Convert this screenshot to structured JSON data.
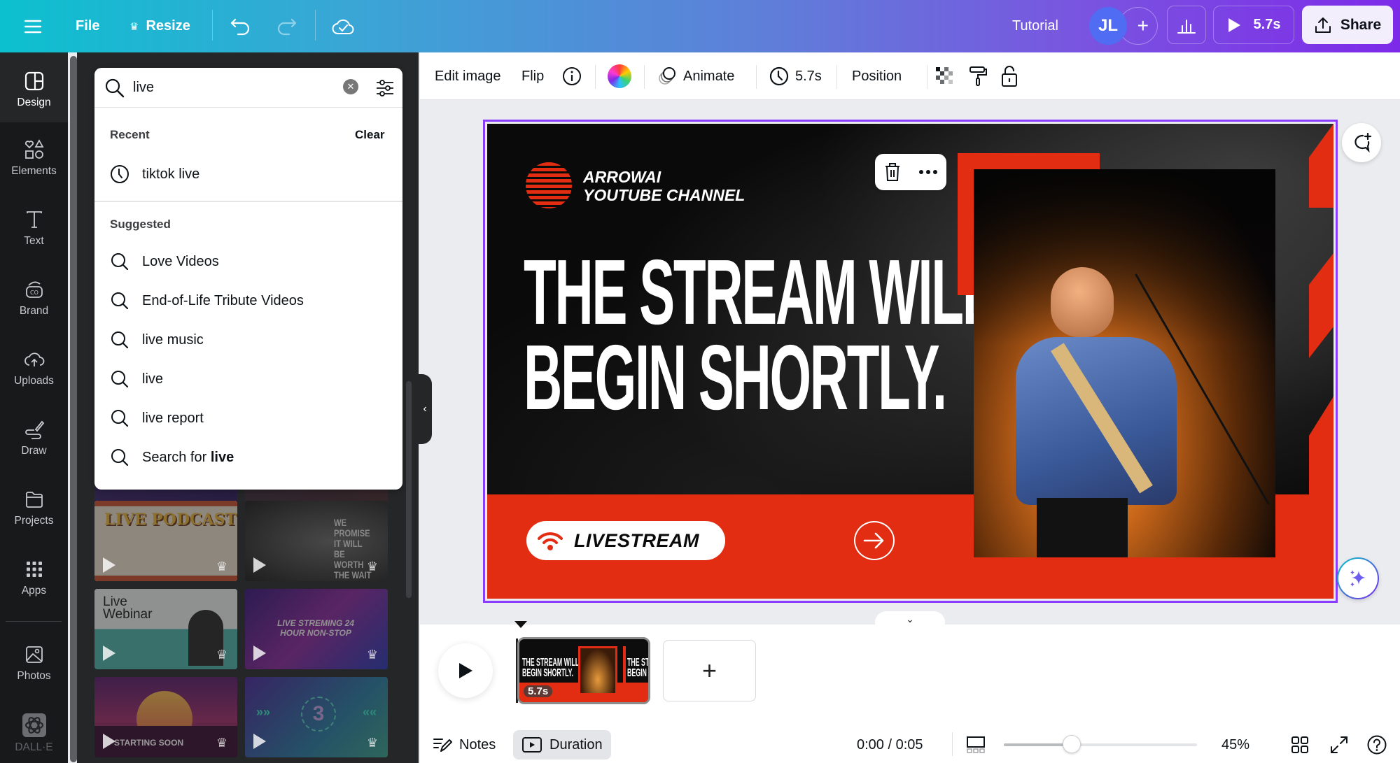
{
  "topbar": {
    "menu_icon": "hamburger-icon",
    "file_label": "File",
    "resize_label": "Resize",
    "resize_icon": "crown-icon",
    "undo_icon": "undo-icon",
    "redo_icon": "redo-icon",
    "saved_icon": "cloud-check-icon",
    "tutorial_label": "Tutorial",
    "avatar_initials": "JL",
    "add_collaborator": "+",
    "insights_icon": "bar-chart-icon",
    "present_duration": "5.7s",
    "share_label": "Share"
  },
  "rail": {
    "items": [
      {
        "label": "Design",
        "icon": "design-icon",
        "active": true
      },
      {
        "label": "Elements",
        "icon": "elements-icon"
      },
      {
        "label": "Text",
        "icon": "text-icon"
      },
      {
        "label": "Brand",
        "icon": "brand-icon"
      },
      {
        "label": "Uploads",
        "icon": "uploads-icon"
      },
      {
        "label": "Draw",
        "icon": "draw-icon"
      },
      {
        "label": "Projects",
        "icon": "projects-icon"
      },
      {
        "label": "Apps",
        "icon": "apps-icon"
      },
      {
        "label": "Photos",
        "icon": "photos-icon"
      },
      {
        "label": "DALL·E",
        "icon": "dalle-icon"
      }
    ]
  },
  "search": {
    "value": "live",
    "recent_label": "Recent",
    "clear_label": "Clear",
    "recent": [
      "tiktok live"
    ],
    "suggested_label": "Suggested",
    "suggested": [
      "Love Videos",
      "End-of-Life Tribute Videos",
      "live music",
      "live",
      "live report"
    ],
    "search_for_prefix": "Search for ",
    "search_for_term": "live"
  },
  "templates": [
    {
      "title": "LIVE PODCAST",
      "premium": true
    },
    {
      "title": "WE PROMISE IT WILL BE WORTH THE WAIT",
      "premium": true
    },
    {
      "title": "Live Webinar",
      "premium": true
    },
    {
      "title": "LIVE STREMING 24 HOUR NON-STOP",
      "premium": true
    },
    {
      "title": "STARTING SOON",
      "premium": true
    },
    {
      "title": "3",
      "premium": true
    }
  ],
  "context_toolbar": {
    "edit_image": "Edit image",
    "flip": "Flip",
    "animate": "Animate",
    "duration": "5.7s",
    "position": "Position"
  },
  "design": {
    "brand_line1": "ARROWAI",
    "brand_line2": "YOUTUBE CHANNEL",
    "headline_line1": "THE STREAM WILL",
    "headline_line2": "BEGIN SHORTLY.",
    "pill_label": "LIVESTREAM",
    "accent_color": "#e32d12"
  },
  "timeline": {
    "clip_duration": "5.7s",
    "add_page": "+"
  },
  "bottombar": {
    "notes_label": "Notes",
    "duration_label": "Duration",
    "time": "0:00 / 0:05",
    "zoom_percent": "45%",
    "zoom_fraction": 0.35
  }
}
